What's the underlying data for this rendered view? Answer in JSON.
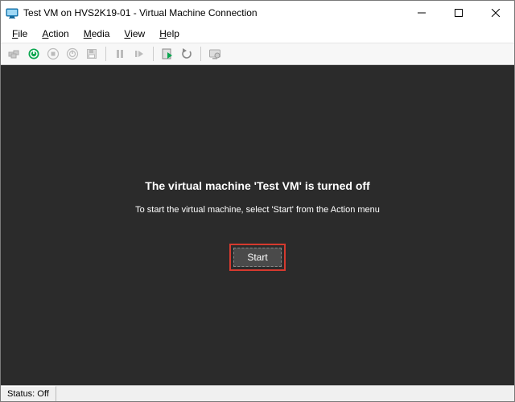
{
  "titlebar": {
    "title": "Test VM on HVS2K19-01 - Virtual Machine Connection"
  },
  "menubar": {
    "file": "File",
    "action": "Action",
    "media": "Media",
    "view": "View",
    "help": "Help"
  },
  "vm": {
    "heading": "The virtual machine 'Test VM' is turned off",
    "subtext": "To start the virtual machine, select 'Start' from the Action menu",
    "start_label": "Start"
  },
  "statusbar": {
    "status": "Status: Off"
  }
}
